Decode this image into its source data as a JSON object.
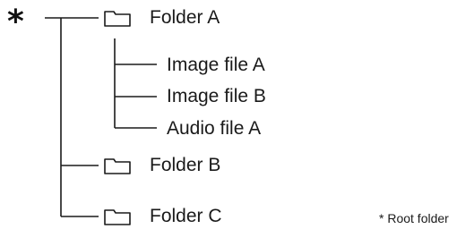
{
  "diagram": {
    "root_marker": "*",
    "folders": [
      {
        "label": "Folder A",
        "icon": "folder-icon",
        "children": [
          {
            "label": "Image file A"
          },
          {
            "label": "Image file B"
          },
          {
            "label": "Audio file A"
          }
        ]
      },
      {
        "label": "Folder B",
        "icon": "folder-icon",
        "children": []
      },
      {
        "label": "Folder C",
        "icon": "folder-icon",
        "children": []
      }
    ],
    "footnote": "* Root folder",
    "line_color": "#1a1a1a"
  }
}
